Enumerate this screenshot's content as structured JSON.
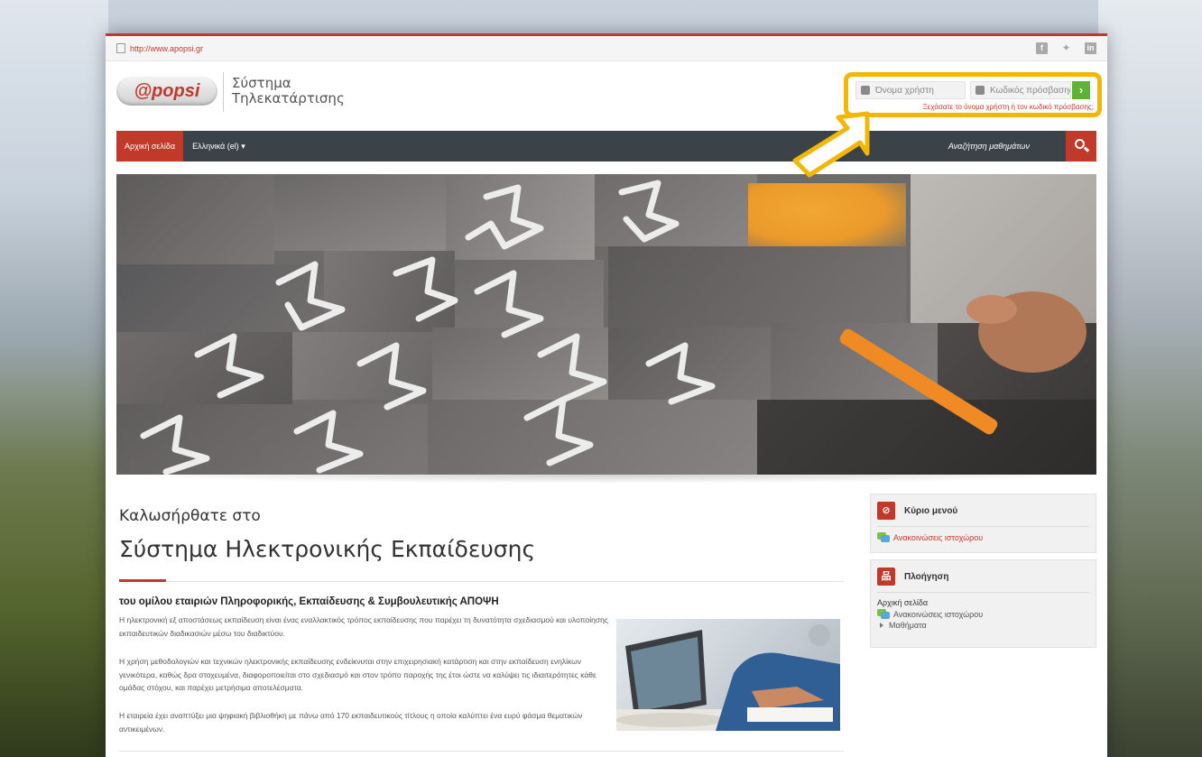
{
  "topbar": {
    "url": "http://www.apopsi.gr",
    "social": [
      "facebook-icon",
      "twitter-icon",
      "linkedin-icon"
    ]
  },
  "header": {
    "logo_text": "@popsi",
    "site_name_line1": "Σύστημα",
    "site_name_line2": "Τηλεκατάρτισης"
  },
  "login": {
    "username_placeholder": "Όνομα χρήστη",
    "password_placeholder": "Κωδικός πρόσβασης",
    "submit_label": "›",
    "forgot_link": "Ξεχάσατε το όνομα χρήστη ή τον κωδικό πρόσβασης;"
  },
  "navbar": {
    "home": "Αρχική σελίδα",
    "language": "Ελληνικά (el) ▾",
    "search_placeholder": "Αναζήτηση μαθημάτων"
  },
  "main": {
    "welcome": "Καλωσήρθατε στο",
    "title": "Σύστημα Ηλεκτρονικής Εκπαίδευσης",
    "subtitle": "του ομίλου εταιριών Πληροφορικής, Εκπαίδευσης & Συμβουλευτικής ΑΠΟΨΗ",
    "paragraph1": "Η ηλεκτρονική εξ αποστάσεως εκπαίδευση είναι ένας εναλλακτικός τρόπος εκπαίδευσης που παρέχει τη δυνατότητα σχεδιασμού και υλοποίησης εκπαιδευτικών διαδικασιών μέσω του διαδικτύου.",
    "paragraph2": "Η χρήση μεθοδολογιών και τεχνικών ηλεκτρονικής εκπαίδευσης ενδείκνυται στην επιχειρησιακή κατάρτιση και στην εκπαίδευση ενηλίκων γενικότερα, καθώς δρα στοχευμένα, διαφοροποιείται στο σχεδιασμό και στον τρόπο παροχής της έτοι ώστε να καλύψει τις ιδιαιτερότητες κάθε ομάδας στόχου, και παρέχει μετρήσιμα αποτελέσματα.",
    "paragraph3": "Η εταιρεία έχει αναπτύξει μια ψηφιακή βιβλιοθήκη με πάνω από 170 εκπαιδευτικούς τίτλους η οποία καλύπτει ένα ευρύ φάσμα θεματικών αντικειμένων."
  },
  "sidebar": {
    "main_menu": {
      "title": "Κύριο μενού",
      "link": "Ανακοινώσεις ιστοχώρου"
    },
    "navigation": {
      "title": "Πλοήγηση",
      "home": "Αρχική σελίδα",
      "announcements": "Ανακοινώσεις ιστοχώρου",
      "courses": "Μαθήματα"
    }
  },
  "colors": {
    "accent": "#c0392b",
    "navbar": "#3b4348",
    "highlight": "#f2b705",
    "go_button": "#5fb233"
  }
}
